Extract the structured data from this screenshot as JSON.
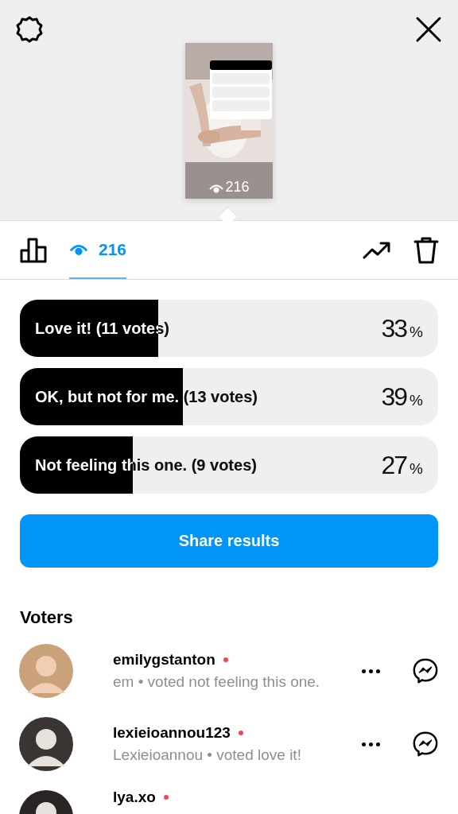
{
  "story": {
    "views": "216"
  },
  "tabs": [
    {
      "kind": "results",
      "selected": false
    },
    {
      "kind": "viewers",
      "label": "216",
      "selected": true
    }
  ],
  "poll": [
    {
      "label": "Love it! (11 votes)",
      "level": 0.33,
      "percent": "33",
      "unit": "%"
    },
    {
      "label": "OK, but not for me. (13 votes)",
      "level": 0.39,
      "percent": "39",
      "unit": "%"
    },
    {
      "label": "Not feeling this one. (9 votes)",
      "level": 0.27,
      "percent": "27",
      "unit": "%"
    }
  ],
  "share_button": "Share results",
  "voters_title": "Voters",
  "voters": [
    {
      "username": "emilygstanton",
      "online": true,
      "name": "em",
      "separator": "•",
      "vote": "voted not feeling this one."
    },
    {
      "username": "lexieioannou123",
      "online": true,
      "name": "Lexieioannou",
      "separator": "•",
      "vote": "voted love it!"
    },
    {
      "username": "lya.xo",
      "online": true
    }
  ]
}
